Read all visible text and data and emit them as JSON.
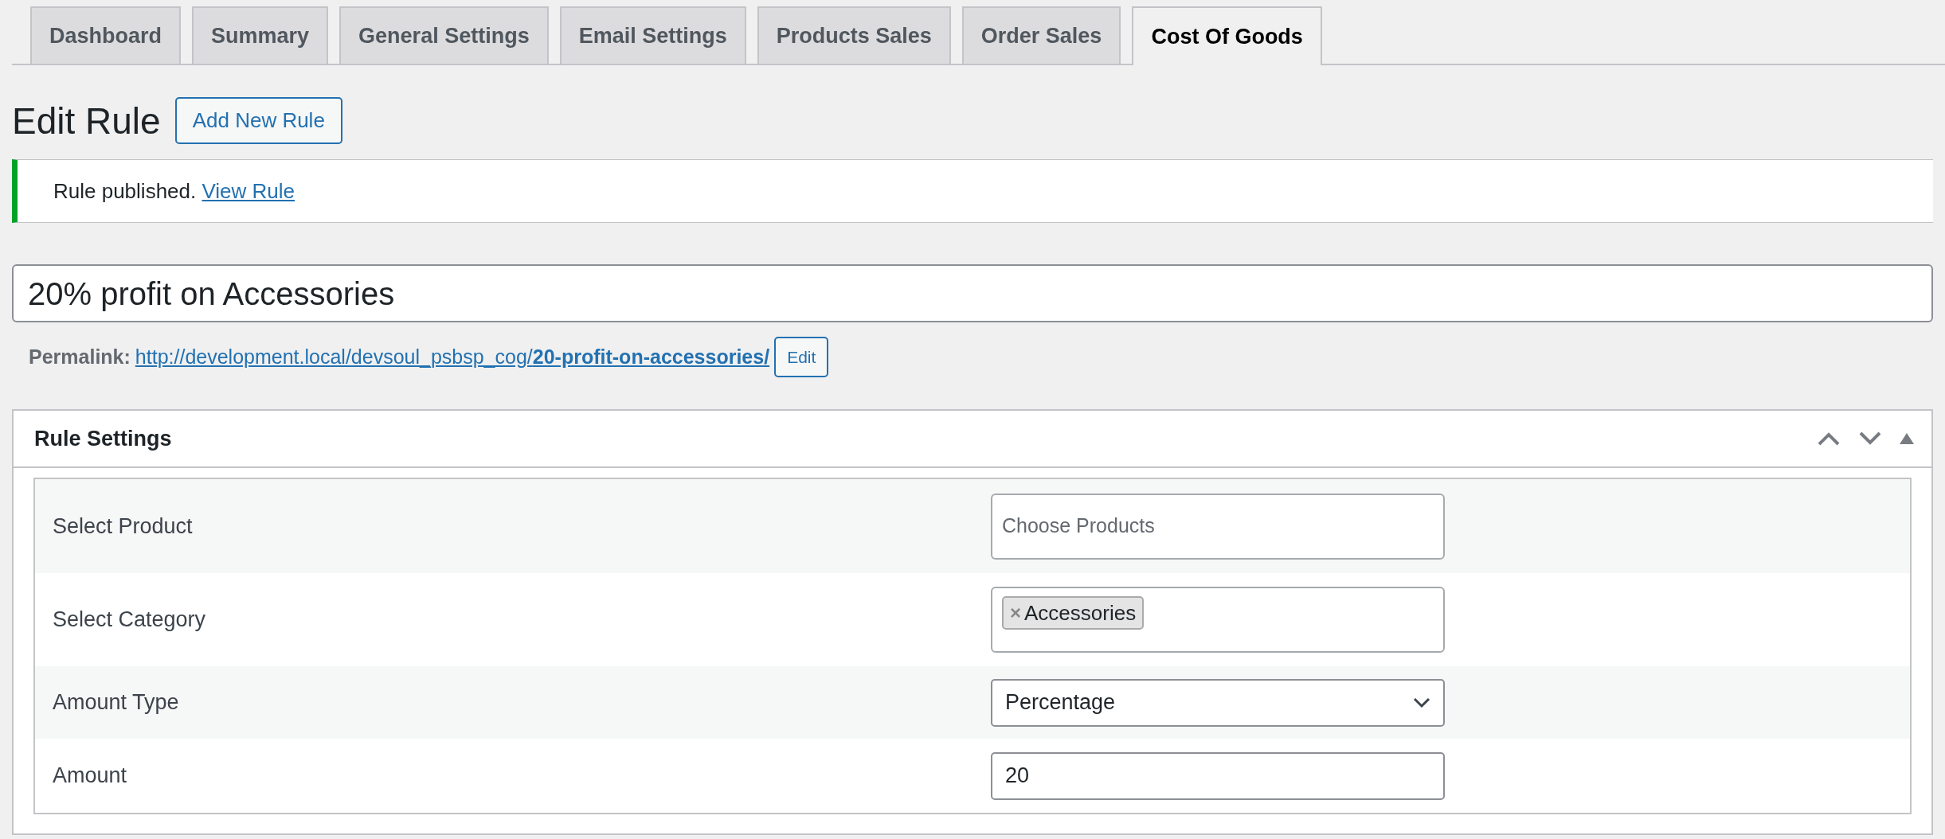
{
  "tabs": [
    {
      "label": "Dashboard",
      "selected": false
    },
    {
      "label": "Summary",
      "selected": false
    },
    {
      "label": "General Settings",
      "selected": false
    },
    {
      "label": "Email Settings",
      "selected": false
    },
    {
      "label": "Products Sales",
      "selected": false
    },
    {
      "label": "Order Sales",
      "selected": false
    },
    {
      "label": "Cost Of Goods",
      "selected": true
    }
  ],
  "heading": "Edit Rule",
  "add_button": "Add New Rule",
  "notice": {
    "text": "Rule published.",
    "link": "View Rule"
  },
  "title_field": {
    "value": "20% profit on Accessories"
  },
  "permalink": {
    "label": "Permalink:",
    "url_base": "http://development.local/devsoul_psbsp_cog/",
    "slug": "20-profit-on-accessories/",
    "edit_button": "Edit"
  },
  "panel": {
    "title": "Rule Settings",
    "rows": [
      {
        "label": "Select Product",
        "kind": "multiselect",
        "placeholder": "Choose Products"
      },
      {
        "label": "Select Category",
        "kind": "tags",
        "tags": [
          {
            "remove": "×",
            "label": "Accessories"
          }
        ]
      },
      {
        "label": "Amount Type",
        "kind": "select",
        "value": "Percentage"
      },
      {
        "label": "Amount",
        "kind": "input",
        "value": "20"
      }
    ]
  }
}
